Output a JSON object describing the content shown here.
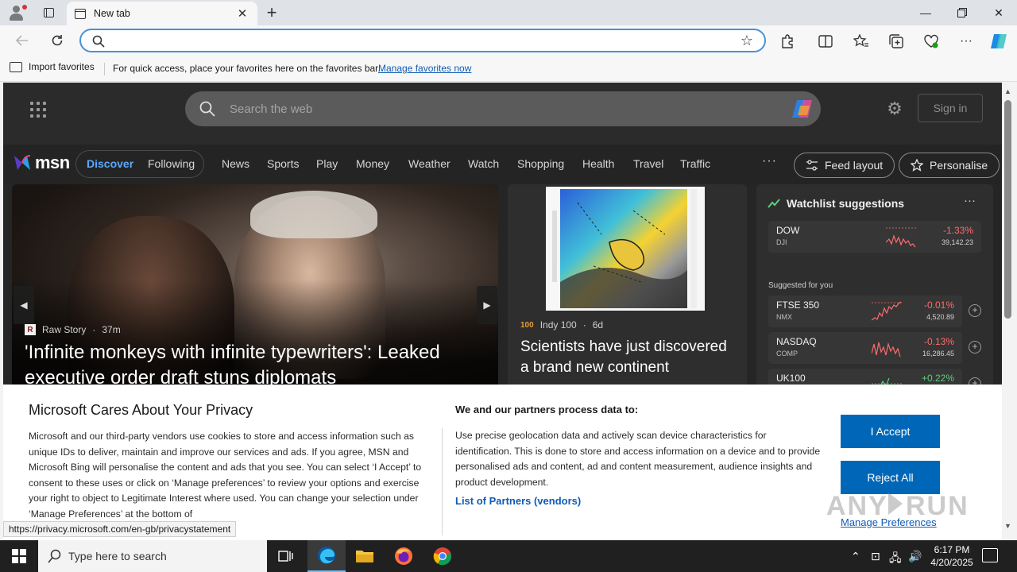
{
  "browser": {
    "tab_title": "New tab",
    "address_value": "",
    "favbar": {
      "import_label": "Import favorites",
      "message": "For quick access, place your favorites here on the favorites bar.",
      "manage_link": "Manage favorites now"
    }
  },
  "msn": {
    "search_placeholder": "Search the web",
    "sign_in": "Sign in",
    "logo_text": "msn",
    "pills": [
      "Discover",
      "Following"
    ],
    "nav_links": [
      "News",
      "Sports",
      "Play",
      "Money",
      "Weather",
      "Watch",
      "Shopping",
      "Health",
      "Travel",
      "Traffic"
    ],
    "more_label": "···",
    "feed_layout": "Feed layout",
    "personalise": "Personalise",
    "hero": {
      "source": "Raw Story",
      "age": "37m",
      "title": "'Infinite monkeys with infinite typewriters': Leaked executive order draft stuns diplomats"
    },
    "card2": {
      "source_logo": "100",
      "source": "Indy 100",
      "age": "6d",
      "title": "Scientists have just discovered a brand new continent"
    },
    "watchlist": {
      "title": "Watchlist suggestions",
      "more": "···",
      "suggested_label": "Suggested for you",
      "quotes": [
        {
          "symbol": "DOW",
          "exchange": "DJI",
          "change": "-1.33%",
          "value": "39,142.23",
          "direction": "neg"
        },
        {
          "symbol": "FTSE 350",
          "exchange": "NMX",
          "change": "-0.01%",
          "value": "4,520.89",
          "direction": "neg"
        },
        {
          "symbol": "NASDAQ",
          "exchange": "COMP",
          "change": "-0.13%",
          "value": "16,286.45",
          "direction": "neg"
        },
        {
          "symbol": "UK100",
          "exchange": "",
          "change": "+0.22%",
          "value": "",
          "direction": "pos"
        }
      ]
    }
  },
  "privacy": {
    "title": "Microsoft Cares About Your Privacy",
    "body": "Microsoft and our third-party vendors use cookies to store and access information such as unique IDs to deliver, maintain and improve our services and ads. If you agree, MSN and Microsoft Bing will personalise the content and ads that you see. You can select ‘I Accept’ to consent to these uses or click on ‘Manage preferences’ to review your options and exercise your right to object to Legitimate Interest where used.  You can change your selection under ‘Manage Preferences’ at the bottom of",
    "subtitle": "We and our partners process data to:",
    "body2": "Use precise geolocation data and actively scan device characteristics for identification. This is done to store and access information on a device and to provide personalised ads and content, ad and content measurement, audience insights and product development.",
    "partners_link": "List of Partners (vendors)",
    "accept": "I Accept",
    "reject": "Reject All",
    "manage": "Manage Preferences"
  },
  "status_url": "https://privacy.microsoft.com/en-gb/privacystatement",
  "watermark": "ANY.RUN",
  "taskbar": {
    "search_placeholder": "Type here to search",
    "time": "6:17 PM",
    "date": "4/20/2025"
  },
  "colors": {
    "accent": "#0067b8",
    "link": "#0f5bb5",
    "negative": "#ff6b6b",
    "positive": "#5ad17a"
  }
}
